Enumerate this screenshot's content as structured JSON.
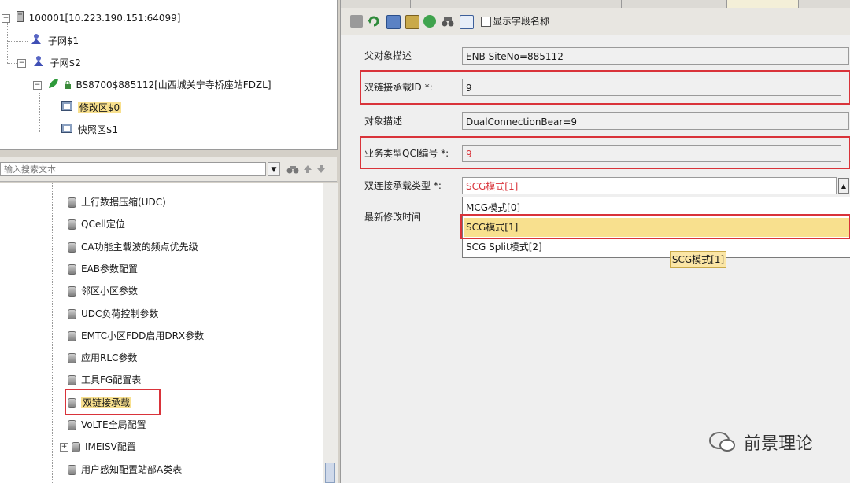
{
  "tree_top": {
    "root": "100001[10.223.190.151:64099]",
    "sub1": "子网$1",
    "sub2": "子网$2",
    "bs": "BS8700$885112[山西城关宁寺桥座站FDZL]",
    "mod1": "修改区$0",
    "mod2": "快照区$1"
  },
  "search": {
    "placeholder": "输入搜索文本"
  },
  "tree_bottom": {
    "items": [
      "上行数据压缩(UDC)",
      "QCell定位",
      "CA功能主载波的频点优先级",
      "EAB参数配置",
      "邻区小区参数",
      "UDC负荷控制参数",
      "EMTC小区FDD启用DRX参数",
      "应用RLC参数",
      "工具FG配置表",
      "双链接承载",
      "VoLTE全局配置",
      "IMEISV配置",
      "用户感知配置站部A类表"
    ]
  },
  "toolbar": {
    "show_field_name": "显示字段名称"
  },
  "form": {
    "parent_label": "父对象描述",
    "parent_value": "ENB SiteNo=885112",
    "bearer_id_label": "双链接承载ID *:",
    "bearer_id_value": "9",
    "obj_desc_label": "对象描述",
    "obj_desc_value": "DualConnectionBear=9",
    "qci_label": "业务类型QCI编号 *:",
    "qci_value": "9",
    "type_label": "双连接承载类型 *:",
    "type_value": "SCG模式[1]",
    "last_modified_label": "最新修改时间"
  },
  "dropdown": {
    "options": [
      "MCG模式[0]",
      "SCG模式[1]",
      "SCG Split模式[2]"
    ],
    "selected_index": 1
  },
  "tooltip": "SCG模式[1]",
  "watermark": "前景理论",
  "colors": {
    "highlight": "#f8e08e",
    "red_box": "#d9333a"
  }
}
